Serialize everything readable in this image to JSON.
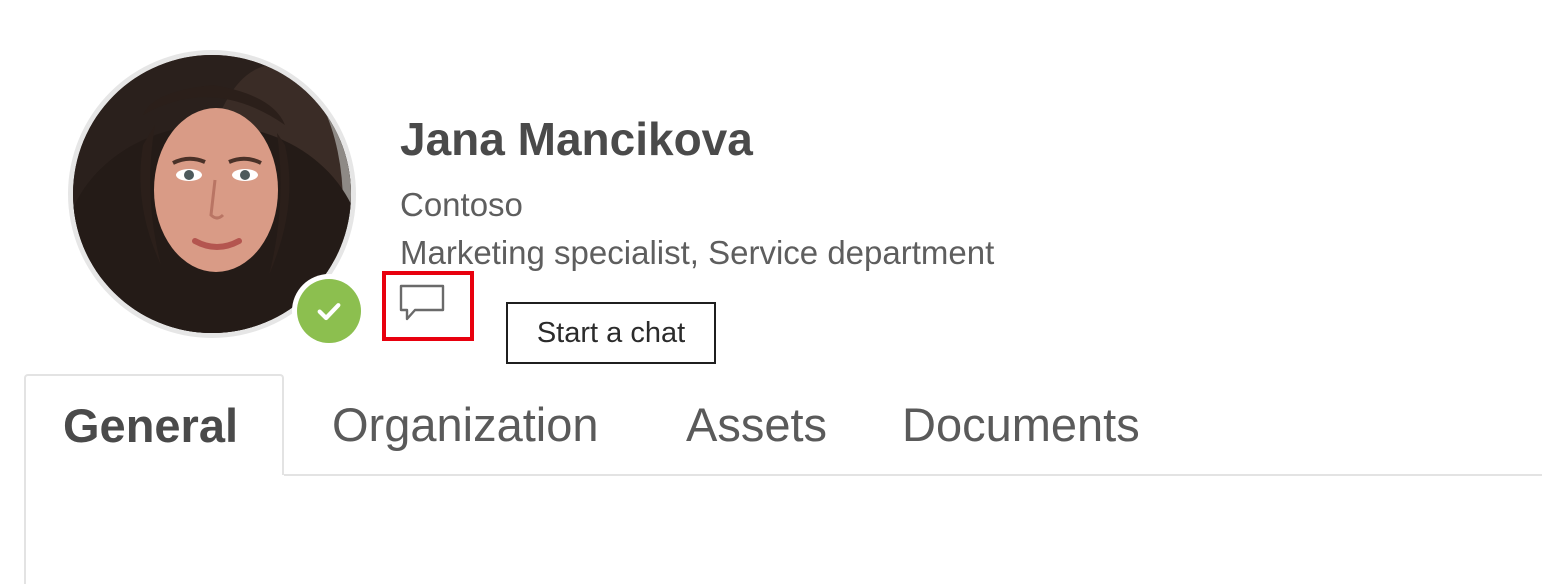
{
  "profile": {
    "name": "Jana Mancikova",
    "company": "Contoso",
    "title": "Marketing specialist, Service department",
    "presence": "available",
    "presence_color": "#8cbf4f"
  },
  "actions": {
    "chat_icon": "chat-bubble-icon",
    "chat_tooltip": "Start a chat",
    "highlight_color": "#e8000e"
  },
  "tabs": [
    {
      "label": "General",
      "active": true
    },
    {
      "label": "Organization",
      "active": false
    },
    {
      "label": "Assets",
      "active": false
    },
    {
      "label": "Documents",
      "active": false
    }
  ]
}
